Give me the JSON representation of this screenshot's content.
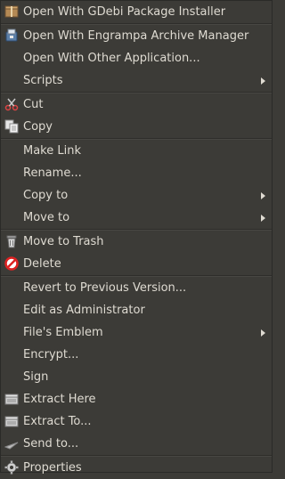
{
  "menu": {
    "items": [
      {
        "label": "Open With GDebi Package Installer",
        "icon": "package-icon"
      },
      {
        "label": "Open With Engrampa Archive Manager",
        "icon": "archive-manager-icon"
      },
      {
        "label": "Open With Other Application...",
        "icon": ""
      },
      {
        "label": "Scripts",
        "icon": "",
        "submenu": true
      },
      {
        "label": "Cut",
        "icon": "scissors-icon"
      },
      {
        "label": "Copy",
        "icon": "copy-icon"
      },
      {
        "label": "Make Link",
        "icon": ""
      },
      {
        "label": "Rename...",
        "icon": ""
      },
      {
        "label": "Copy to",
        "icon": "",
        "submenu": true
      },
      {
        "label": "Move to",
        "icon": "",
        "submenu": true
      },
      {
        "label": "Move to Trash",
        "icon": "trash-icon"
      },
      {
        "label": "Delete",
        "icon": "delete-icon"
      },
      {
        "label": "Revert to Previous Version...",
        "icon": ""
      },
      {
        "label": "Edit as Administrator",
        "icon": ""
      },
      {
        "label": "File's Emblem",
        "icon": "",
        "submenu": true
      },
      {
        "label": "Encrypt...",
        "icon": ""
      },
      {
        "label": "Sign",
        "icon": ""
      },
      {
        "label": "Extract Here",
        "icon": "extract-here-icon"
      },
      {
        "label": "Extract To...",
        "icon": "extract-to-icon"
      },
      {
        "label": "Send to...",
        "icon": "send-to-icon"
      },
      {
        "label": "Properties",
        "icon": "gear-icon"
      }
    ]
  },
  "colors": {
    "background": "#3c3b37",
    "text": "#dfdbd2",
    "highlight": "#f07746"
  }
}
